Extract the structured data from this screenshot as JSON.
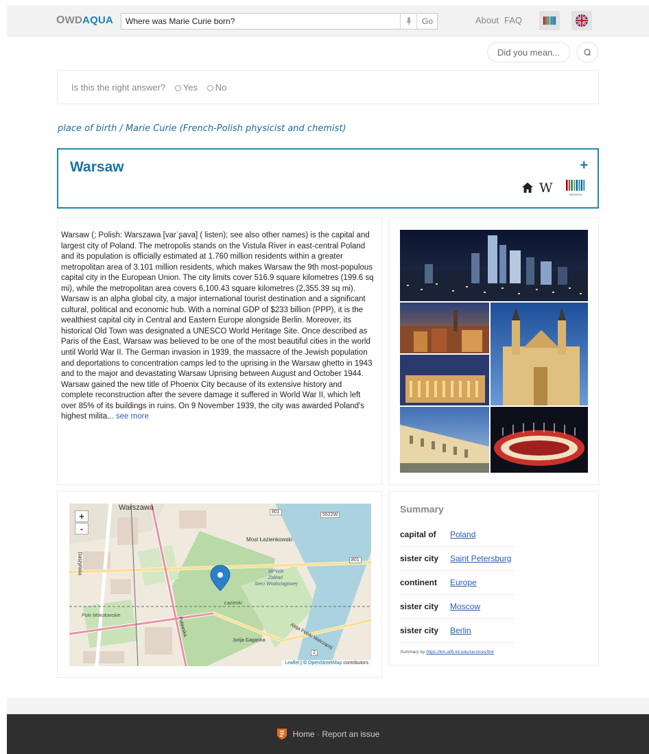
{
  "header": {
    "logo_o": "O",
    "logo_wd": "WD",
    "logo_aqua": "AQUA",
    "search_value": "Where was Marie Curie born?",
    "go_label": "Go",
    "about_label": "About",
    "faq_label": "FAQ"
  },
  "did_you_mean_label": "Did you mean...",
  "feedback": {
    "question": "Is this the right answer?",
    "yes": "Yes",
    "no": "No"
  },
  "property_path": "place of birth / Marie Curie (French-Polish physicist and chemist)",
  "answer": {
    "title": "Warsaw",
    "plus": "+",
    "wikidata_label": "WIKIDATA"
  },
  "abstract": {
    "text": "Warsaw (; Polish: Warszawa [varˈʂava] ( listen); see also other names) is the capital and largest city of Poland. The metropolis stands on the Vistula River in east-central Poland and its population is officially estimated at 1.760 million residents within a greater metropolitan area of 3.101 million residents, which makes Warsaw the 9th most-populous capital city in the European Union. The city limits cover 516.9 square kilometres (199.6 sq mi), while the metropolitan area covers 6,100.43 square kilometres (2,355.39 sq mi). Warsaw is an alpha global city, a major international tourist destination and a significant cultural, political and economic hub. With a nominal GDP of $233 billion (PPP), it is the wealthiest capital city in Central and Eastern Europe alongside Berlin. Moreover, its historical Old Town was designated a UNESCO World Heritage Site. Once described as Paris of the East, Warsaw was believed to be one of the most beautiful cities in the world until World War II. The German invasion in 1939, the massacre of the Jewish population and deportations to concentration camps led to the uprising in the Warsaw ghetto in 1943 and to the major and devastating Warsaw Uprising between August and October 1944. Warsaw gained the new title of Phoenix City because of its extensive history and complete reconstruction after the severe damage it suffered in World War II, which left over 85% of its buildings in ruins. On 9 November 1939, the city was awarded Poland's highest milita...",
    "see_more": "see more"
  },
  "map": {
    "zoom_in": "+",
    "zoom_out": "-",
    "labels": {
      "warszawa": "Warszawa",
      "road_801a": "801",
      "road_801b": "801",
      "road_5522w": "5522W",
      "most": "Most Łazienkowski",
      "mpwik": "MPWiK",
      "zaklad": "Zakład",
      "sieci": "Sieci Wodociągowej",
      "lazienki": "Łazienki",
      "pole": "Pole Mokotowskie",
      "jurija": "Jurija Gagarina",
      "aleja": "Aleja Polski Walczącej",
      "road_2": "2",
      "dazynska": "Daszyńska",
      "pulawska": "Puławska"
    },
    "attribution_leaflet": "Leaflet",
    "attribution_sep": " | © ",
    "attribution_osm": "OpenStreetMap",
    "attribution_tail": " contributors"
  },
  "summary": {
    "title": "Summary",
    "rows": [
      {
        "key": "capital of",
        "value": "Poland"
      },
      {
        "key": "sister city",
        "value": "Saint Petersburg"
      },
      {
        "key": "continent",
        "value": "Europe"
      },
      {
        "key": "sister city",
        "value": "Moscow"
      },
      {
        "key": "sister city",
        "value": "Berlin"
      }
    ],
    "credit_prefix": "Summary by ",
    "credit_link": "https://km.aifb.kit.edu/services/link"
  },
  "footer": {
    "home": "Home",
    "separator": " · ",
    "report": "Report an issue"
  },
  "colors": {
    "accent": "#1a73a8",
    "answer_border": "#1c88b5",
    "footer_bg": "#2f2f2f"
  }
}
